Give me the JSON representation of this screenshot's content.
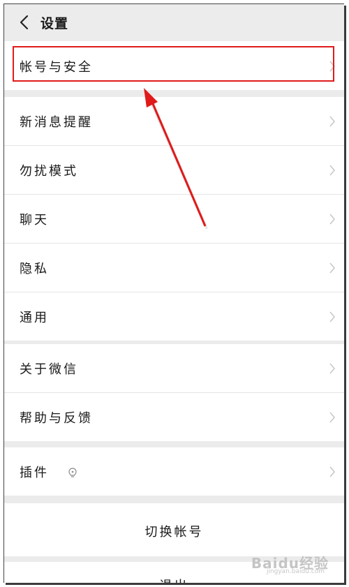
{
  "header": {
    "title": "设置"
  },
  "group1": {
    "items": [
      {
        "label": "帐号与安全"
      }
    ]
  },
  "group2": {
    "items": [
      {
        "label": "新消息提醒"
      },
      {
        "label": "勿扰模式"
      },
      {
        "label": "聊天"
      },
      {
        "label": "隐私"
      },
      {
        "label": "通用"
      }
    ]
  },
  "group3": {
    "items": [
      {
        "label": "关于微信"
      },
      {
        "label": "帮助与反馈"
      }
    ]
  },
  "group4": {
    "items": [
      {
        "label": "插件"
      }
    ]
  },
  "actions": {
    "switch_account": "切换帐号",
    "logout": "退出"
  },
  "watermark": {
    "brand": "Baidu经验",
    "url": "jingyan.baidu.com"
  },
  "colors": {
    "highlight": "#e01a1a",
    "background": "#ebebeb"
  }
}
